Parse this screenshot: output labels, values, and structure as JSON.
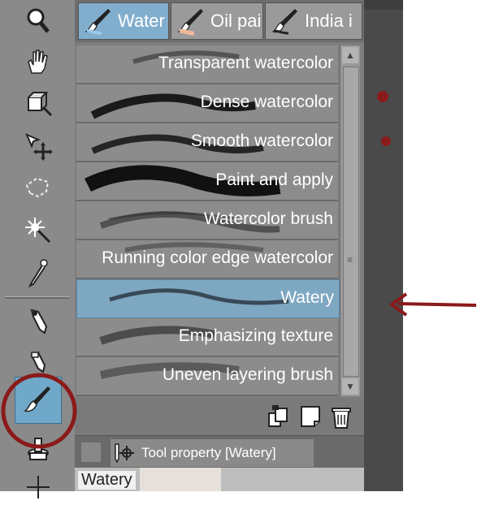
{
  "tabs": [
    {
      "label": "Water",
      "active": true
    },
    {
      "label": "Oil pai",
      "active": false
    },
    {
      "label": "India i",
      "active": false
    }
  ],
  "brushes": [
    {
      "name": "Transparent watercolor",
      "selected": false
    },
    {
      "name": "Dense watercolor",
      "selected": false
    },
    {
      "name": "Smooth watercolor",
      "selected": false
    },
    {
      "name": "Paint and apply",
      "selected": false
    },
    {
      "name": "Watercolor brush",
      "selected": false
    },
    {
      "name": "Running color edge watercolor",
      "selected": false
    },
    {
      "name": "Watery",
      "selected": true
    },
    {
      "name": "Emphasizing texture",
      "selected": false
    },
    {
      "name": "Uneven layering brush",
      "selected": false
    }
  ],
  "tools": [
    "zoom-icon",
    "hand-icon",
    "operation-icon",
    "move-layer-icon",
    "lasso-icon",
    "magic-wand-icon",
    "eyedropper-icon",
    "pen-icon",
    "pencil-icon",
    "brush-icon",
    "stamp-icon",
    "decoration-icon"
  ],
  "selected_tool": "brush-icon",
  "tool_property": {
    "header": "Tool property [Watery]",
    "name": "Watery"
  },
  "colors": {
    "accent": "#82aecd",
    "annotation": "#8b1a1a"
  }
}
